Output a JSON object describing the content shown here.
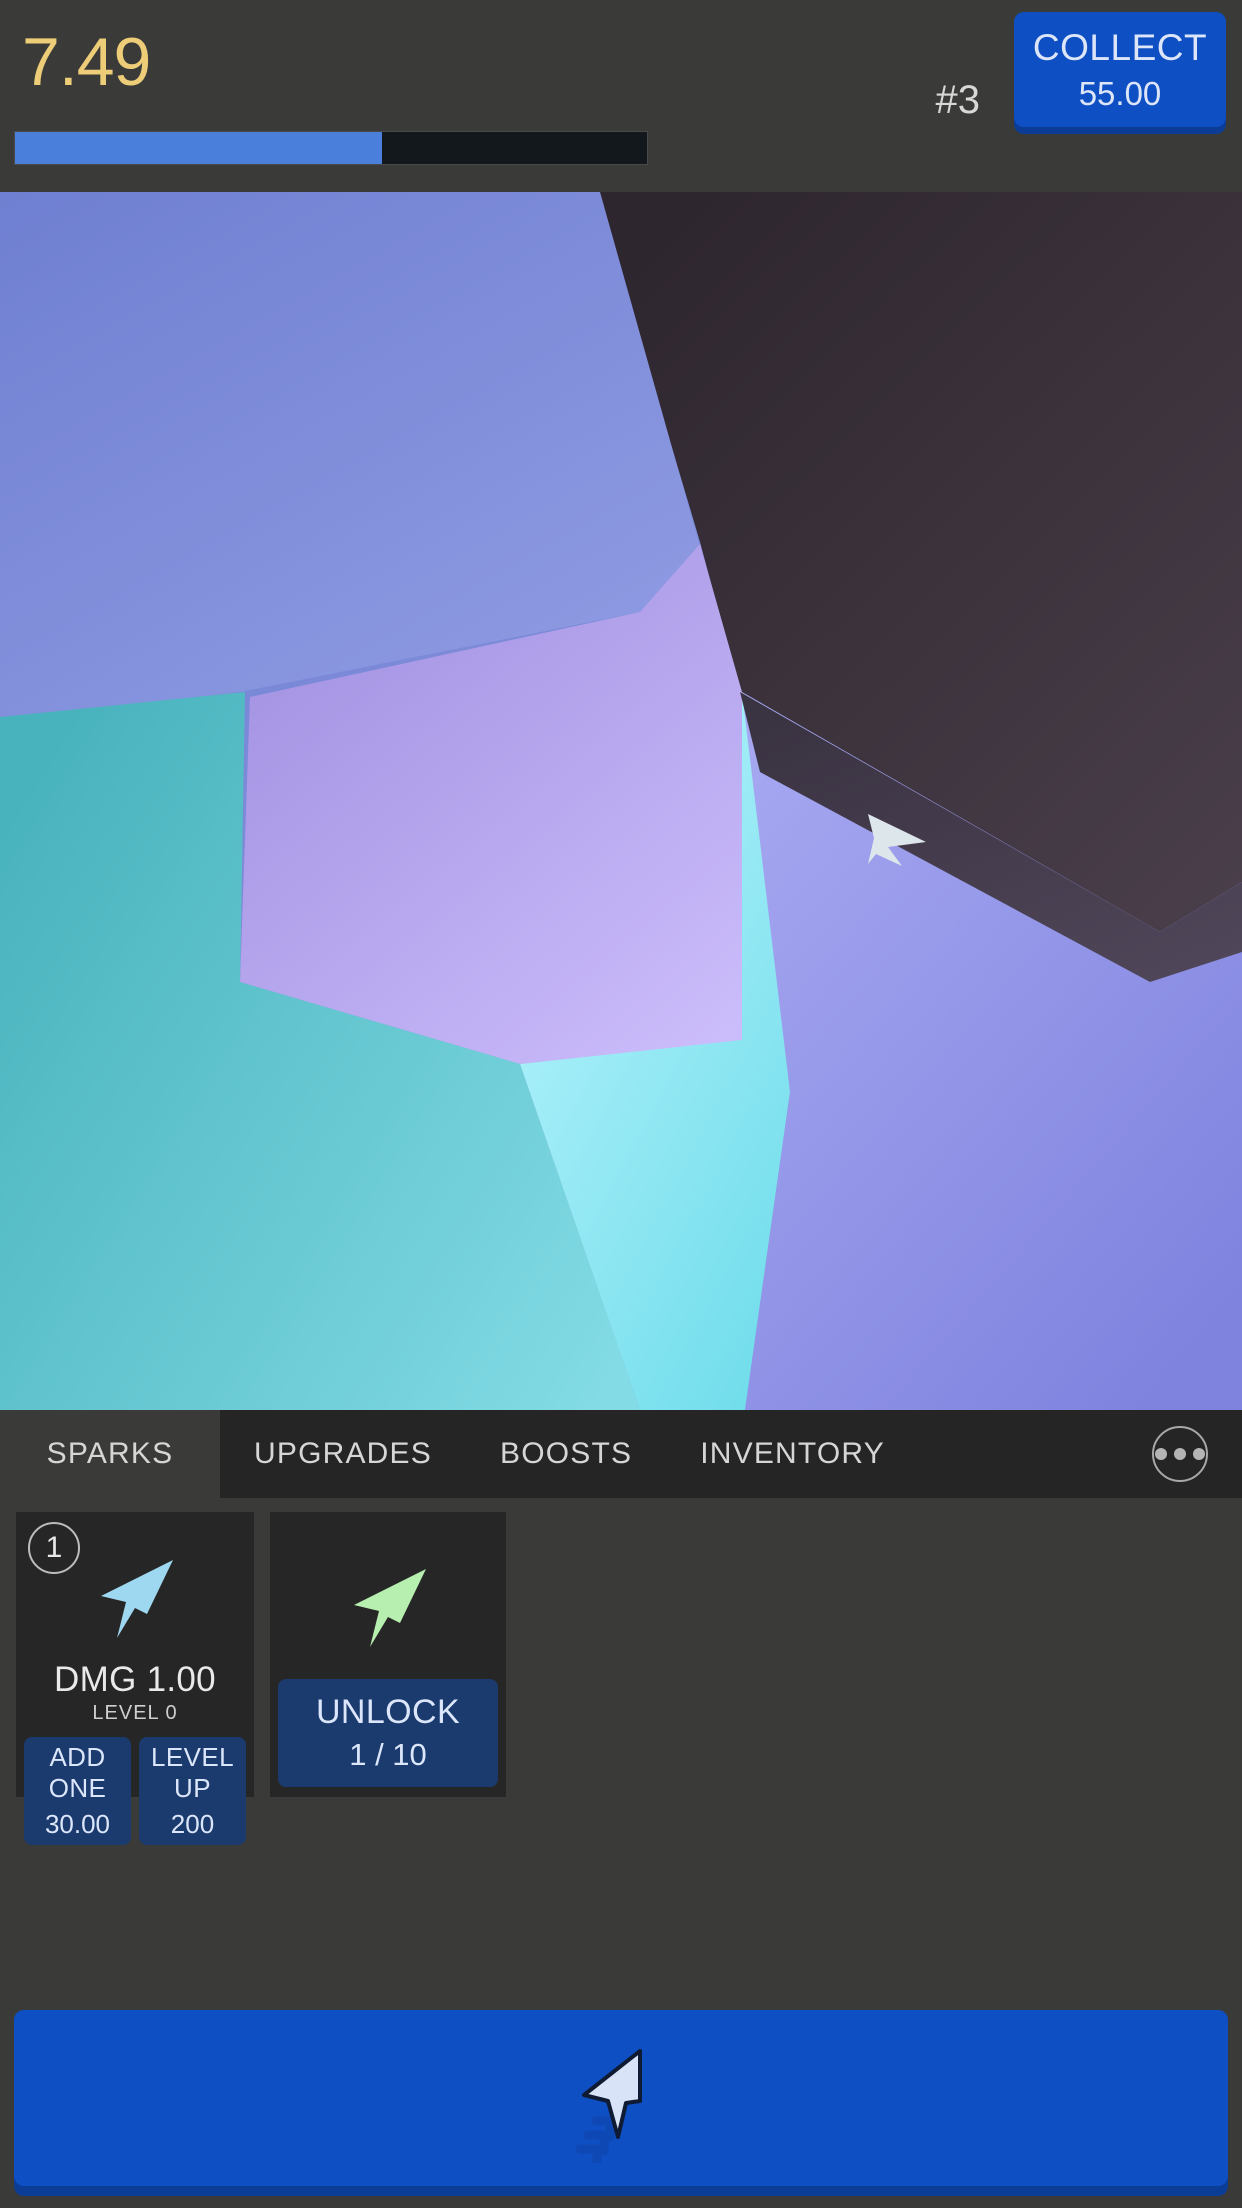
{
  "hud": {
    "currency_value": "7.49",
    "rank_label": "#3",
    "progress_percent": 58,
    "collect": {
      "label": "COLLECT",
      "value": "55.00"
    }
  },
  "canvas": {
    "cursor_icon": "arrow-cursor-icon",
    "cell_colors": [
      "#7c8ad6",
      "#3b3039",
      "#b6a2ee",
      "#63c4cd",
      "#9fe9f5",
      "#8e92e8"
    ]
  },
  "tabs": [
    {
      "label": "SPARKS",
      "active": true
    },
    {
      "label": "UPGRADES",
      "active": false
    },
    {
      "label": "BOOSTS",
      "active": false
    },
    {
      "label": "INVENTORY",
      "active": false
    }
  ],
  "more_menu": {
    "icon": "ellipsis-icon"
  },
  "cards": [
    {
      "badge": "1",
      "icon": "arrow-spark-icon",
      "icon_color": "#9ed7f0",
      "title": "DMG 1.00",
      "subtitle": "LEVEL 0",
      "actions": [
        {
          "label": "ADD ONE",
          "value": "30.00"
        },
        {
          "label": "LEVEL UP",
          "value": "200"
        }
      ]
    },
    {
      "badge": "",
      "icon": "arrow-spark-icon",
      "icon_color": "#b6efb0",
      "title": "",
      "subtitle": "",
      "actions": [
        {
          "label": "UNLOCK",
          "value": "1 / 10"
        }
      ]
    }
  ],
  "big_action": {
    "icon": "click-cursor-icon",
    "color": "#0e4fc4"
  },
  "colors": {
    "accent_blue": "#0e4fc4",
    "accent_blue_dark": "#0b3c96",
    "currency_gold": "#edcd78",
    "panel_bg": "#3a3a38",
    "card_bg": "#262626",
    "tabbar_bg": "#252525",
    "button_navy": "#1b3a6e",
    "progress_fill": "#4a7fdc",
    "progress_track": "#12181b"
  }
}
